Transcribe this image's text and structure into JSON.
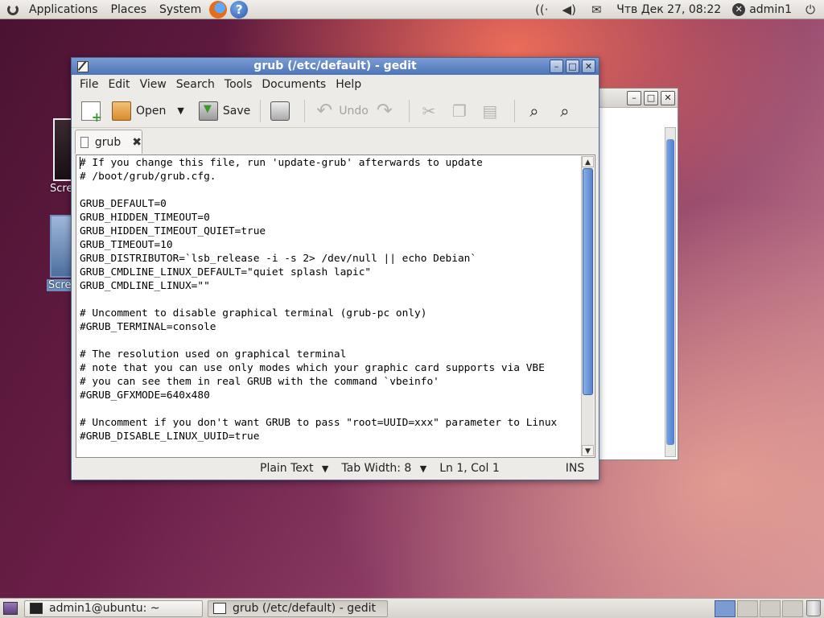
{
  "top_panel": {
    "menus": [
      "Applications",
      "Places",
      "System"
    ],
    "clock": "Чтв Дек 27, 08:22",
    "user": "admin1"
  },
  "desktop": {
    "icons": [
      {
        "label": "Scre"
      },
      {
        "label": "Scre"
      }
    ]
  },
  "window": {
    "title": "grub (/etc/default) - gedit",
    "menu": [
      "File",
      "Edit",
      "View",
      "Search",
      "Tools",
      "Documents",
      "Help"
    ],
    "toolbar": {
      "open_label": "Open",
      "save_label": "Save",
      "undo_label": "Undo"
    },
    "tab_label": "grub",
    "content": [
      "# If you change this file, run 'update-grub' afterwards to update",
      "# /boot/grub/grub.cfg.",
      "",
      "GRUB_DEFAULT=0",
      "GRUB_HIDDEN_TIMEOUT=0",
      "GRUB_HIDDEN_TIMEOUT_QUIET=true",
      "GRUB_TIMEOUT=10",
      "GRUB_DISTRIBUTOR=`lsb_release -i -s 2> /dev/null || echo Debian`",
      "GRUB_CMDLINE_LINUX_DEFAULT=\"quiet splash lapic\"",
      "GRUB_CMDLINE_LINUX=\"\"",
      "",
      "# Uncomment to disable graphical terminal (grub-pc only)",
      "#GRUB_TERMINAL=console",
      "",
      "# The resolution used on graphical terminal",
      "# note that you can use only modes which your graphic card supports via VBE",
      "# you can see them in real GRUB with the command `vbeinfo'",
      "#GRUB_GFXMODE=640x480",
      "",
      "# Uncomment if you don't want GRUB to pass \"root=UUID=xxx\" parameter to Linux",
      "#GRUB_DISABLE_LINUX_UUID=true"
    ],
    "status": {
      "language": "Plain Text",
      "tab_width": "Tab Width:  8",
      "position": "Ln 1, Col 1",
      "mode": "INS"
    }
  },
  "bottom_panel": {
    "tasks": [
      {
        "label": "admin1@ubuntu: ~"
      },
      {
        "label": "grub (/etc/default) - gedit"
      }
    ]
  }
}
